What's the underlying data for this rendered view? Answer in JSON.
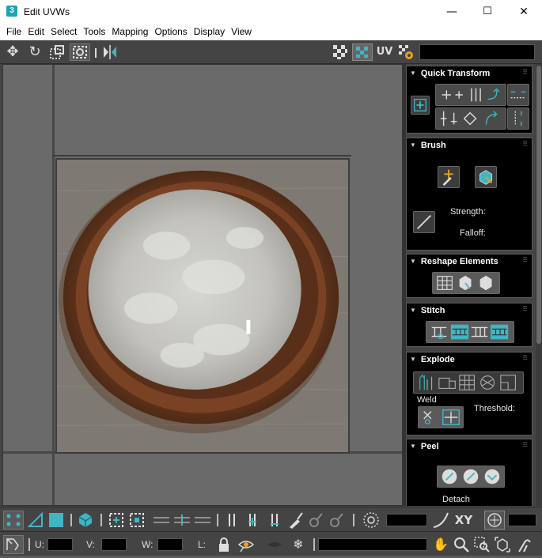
{
  "window": {
    "title": "Edit UVWs",
    "app_icon": "3",
    "minimize": "—",
    "maximize": "☐",
    "close": "✕"
  },
  "menu": [
    "File",
    "Edit",
    "Select",
    "Tools",
    "Mapping",
    "Options",
    "Display",
    "View"
  ],
  "toolbar": {
    "uv_label": "UV",
    "icons": [
      "move-icon",
      "rotate-icon",
      "scale-icon",
      "freeform-icon",
      "mirror-icon",
      "checker-icon",
      "texture-icon",
      "settings-icon"
    ]
  },
  "panel": {
    "quick_transform": {
      "title": "Quick Transform"
    },
    "brush": {
      "title": "Brush",
      "strength_label": "Strength:",
      "falloff_label": "Falloff:"
    },
    "reshape": {
      "title": "Reshape Elements"
    },
    "stitch": {
      "title": "Stitch"
    },
    "explode": {
      "title": "Explode",
      "weld_label": "Weld",
      "threshold_label": "Threshold:"
    },
    "peel": {
      "title": "Peel",
      "detach_label": "Detach"
    }
  },
  "bottom": {
    "xy_label": "XY",
    "u_label": "U:",
    "v_label": "V:",
    "w_label": "W:",
    "l_label": "L:"
  },
  "colors": {
    "accent_teal": "#3fb6c4",
    "panel_bg": "#000000",
    "chrome": "#444444"
  }
}
